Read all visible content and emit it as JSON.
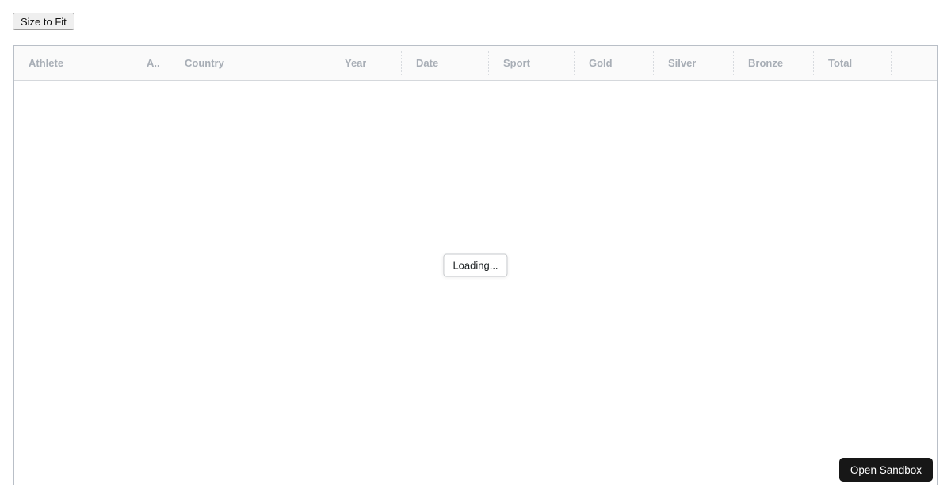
{
  "toolbar": {
    "size_to_fit_label": "Size to Fit"
  },
  "grid": {
    "columns": [
      {
        "label": "Athlete"
      },
      {
        "label": "A.."
      },
      {
        "label": "Country"
      },
      {
        "label": "Year"
      },
      {
        "label": "Date"
      },
      {
        "label": "Sport"
      },
      {
        "label": "Gold"
      },
      {
        "label": "Silver"
      },
      {
        "label": "Bronze"
      },
      {
        "label": "Total"
      }
    ],
    "loading_label": "Loading..."
  },
  "sandbox": {
    "open_label": "Open Sandbox"
  },
  "colors": {
    "grid_border": "#b9bfc7",
    "header_background": "#fafafa",
    "header_text": "#a8aeb6",
    "loading_box_border": "#c7cacd",
    "loading_text": "#181d1f",
    "sandbox_button_background": "#171717",
    "sandbox_button_text": "#ffffff"
  }
}
